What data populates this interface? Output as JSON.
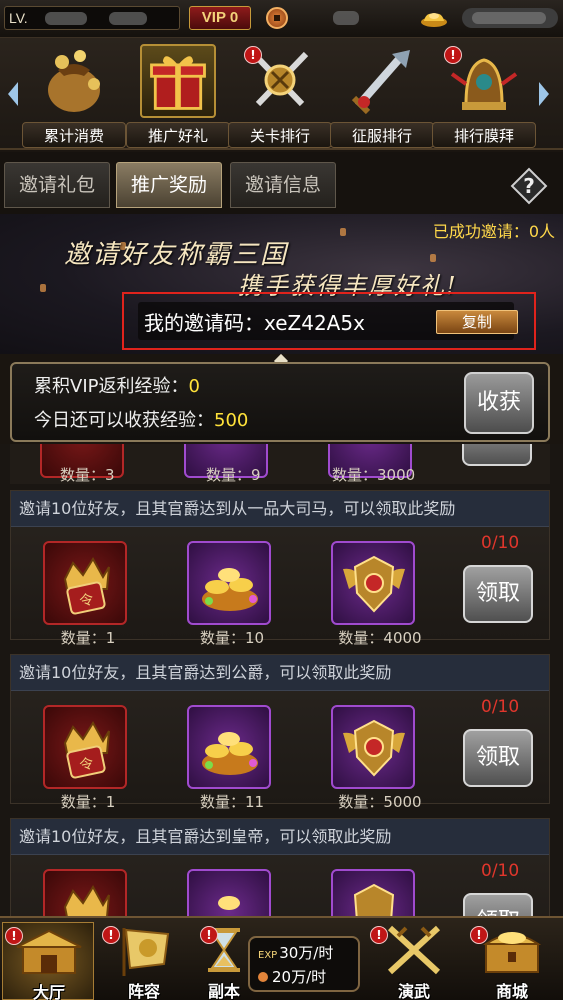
{
  "topbar": {
    "level_label": "LV.",
    "vip_label": "VIP 0"
  },
  "activities": [
    {
      "label": "累计消费",
      "icon": "money-bag-icon",
      "selected": false
    },
    {
      "label": "推广好礼",
      "icon": "gift-box-icon",
      "selected": true
    },
    {
      "label": "关卡排行",
      "icon": "crossed-swords-icon",
      "selected": false
    },
    {
      "label": "征服排行",
      "icon": "sword-icon",
      "selected": false
    },
    {
      "label": "排行膜拜",
      "icon": "bell-icon",
      "selected": false
    }
  ],
  "tabs": [
    "邀请礼包",
    "推广奖励",
    "邀请信息"
  ],
  "active_tab": "推广奖励",
  "banner": {
    "invited_text": "已成功邀请：0人",
    "slogan_line1": "邀请好友称霸三国",
    "slogan_line2": "携手获得丰厚好礼!",
    "code_label": "我的邀请码：xeZ42A5x",
    "copy_button": "复制"
  },
  "exp_panel": {
    "vip_label": "累积VIP返利经验：",
    "vip_value": "0",
    "today_label": "今日还可以收获经验：",
    "today_value": "500",
    "harvest_button": "收获"
  },
  "partial_row": {
    "qtys": [
      "数量：3",
      "数量：9",
      "数量：3000"
    ]
  },
  "reward_cards": [
    {
      "desc": "邀请10位好友，且其官爵达到从一品大司马，可以领取此奖励",
      "progress": "0/10",
      "claim_label": "领取",
      "qtys": [
        "数量：1",
        "数量：10",
        "数量：4000"
      ]
    },
    {
      "desc": "邀请10位好友，且其官爵达到公爵，可以领取此奖励",
      "progress": "0/10",
      "claim_label": "领取",
      "qtys": [
        "数量：1",
        "数量：11",
        "数量：5000"
      ]
    },
    {
      "desc": "邀请10位好友，且其官爵达到皇帝，可以领取此奖励",
      "progress": "0/10",
      "claim_label": "领取",
      "qtys": [
        "",
        "",
        ""
      ]
    }
  ],
  "bottom_nav": [
    {
      "label": "大厅",
      "icon": "palace-icon",
      "selected": true
    },
    {
      "label": "阵容",
      "icon": "banner-flag-icon",
      "selected": false
    },
    {
      "label": "副本",
      "icon": "hourglass-icon",
      "selected": false
    },
    {
      "label": "演武",
      "icon": "crossed-swords-icon",
      "selected": false
    },
    {
      "label": "商城",
      "icon": "treasure-chest-icon",
      "selected": false
    }
  ],
  "exp_rates": {
    "exp_tag": "EXP",
    "exp_rate": "30万/时",
    "coin_rate": "20万/时"
  },
  "colors": {
    "highlight_yellow": "#ffe23a",
    "progress_red": "#e0362c",
    "code_border_red": "#e0231c",
    "gold": "#c79a3a"
  }
}
